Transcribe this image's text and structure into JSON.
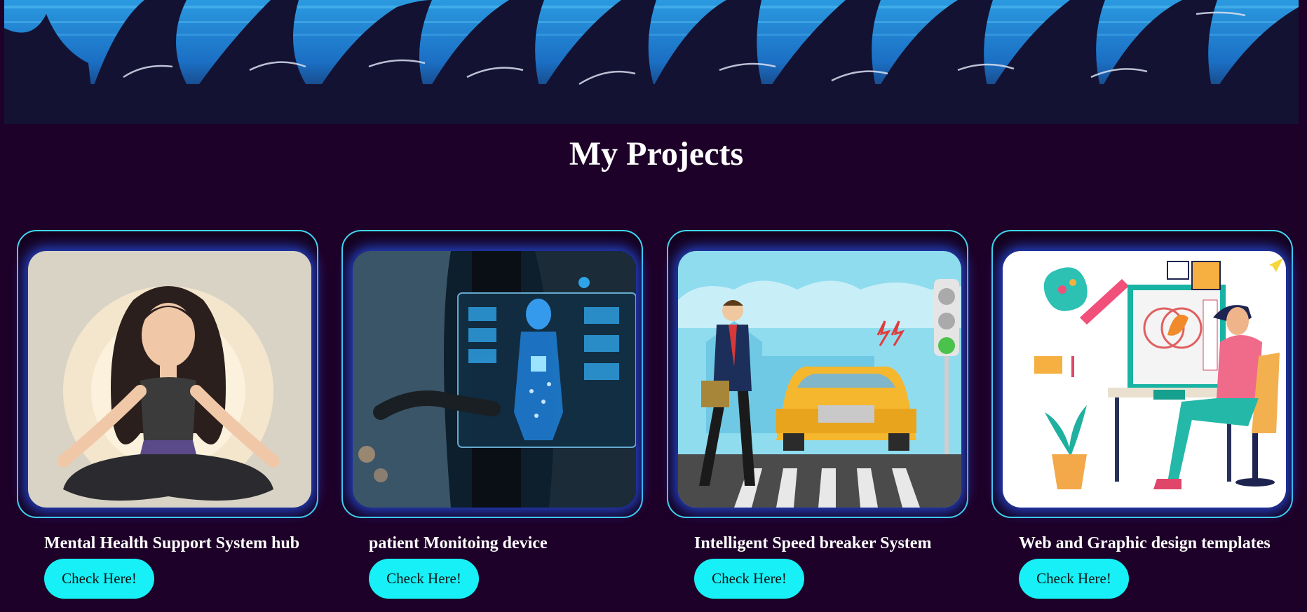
{
  "section": {
    "title": "My Projects"
  },
  "projects": [
    {
      "title": "Mental Health Support System hub",
      "button": "Check Here!",
      "image": "meditating-woman-illustration"
    },
    {
      "title": "patient Monitoing device",
      "button": "Check Here!",
      "image": "medical-hologram-illustration"
    },
    {
      "title": "Intelligent Speed breaker System",
      "button": "Check Here!",
      "image": "crosswalk-car-illustration"
    },
    {
      "title": "Web and Graphic design templates",
      "button": "Check Here!",
      "image": "graphic-designer-illustration"
    }
  ],
  "colors": {
    "background": "#1e0128",
    "accent": "#17f0f6",
    "card_border": "#3fd6f0",
    "glow": "#285aff"
  }
}
